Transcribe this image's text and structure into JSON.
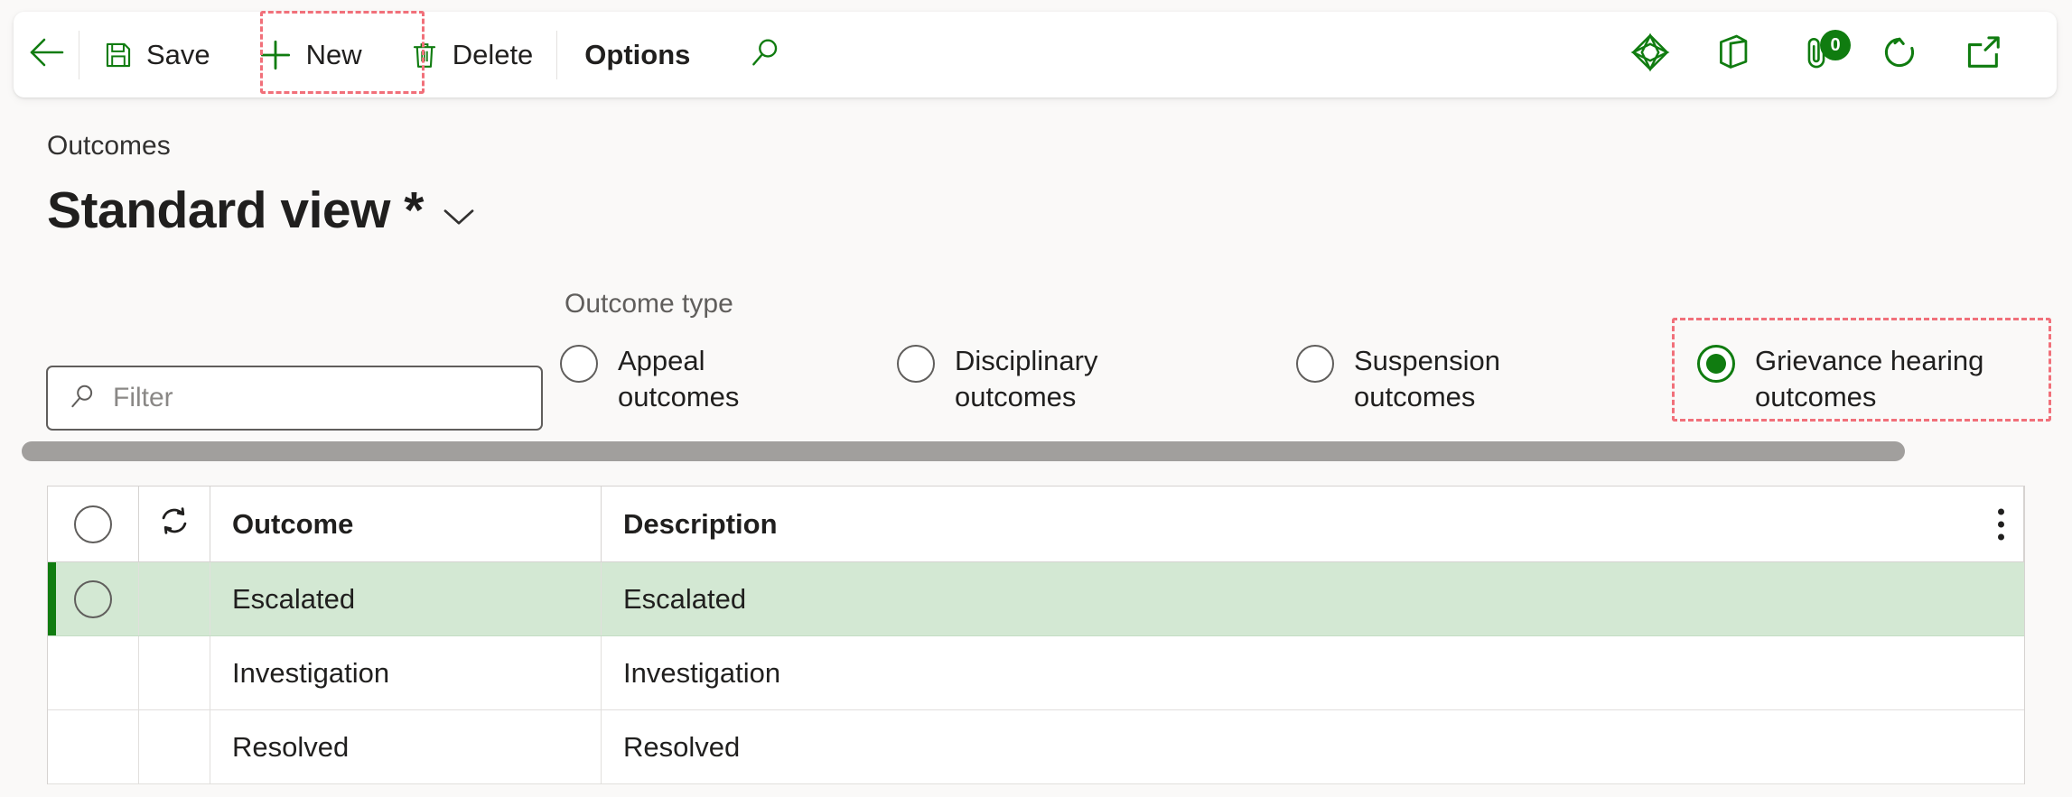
{
  "colors": {
    "accent_green": "#107c10",
    "highlight_red": "#f1707a",
    "selected_row_bg": "#d3e8d3",
    "page_bg": "#faf9f8"
  },
  "commandbar": {
    "back_label": "Back",
    "save_label": "Save",
    "new_label": "New",
    "delete_label": "Delete",
    "options_label": "Options",
    "search_label": "Search",
    "attachments_badge": "0",
    "icons": {
      "back": "back-arrow-icon",
      "save": "floppy-disk-save-icon",
      "new": "plus-icon",
      "delete": "trash-can-icon",
      "search": "magnifier-icon",
      "powerapps": "power-apps-diamond-icon",
      "office": "office-app-launcher-icon",
      "attachments": "paperclip-icon",
      "refresh": "refresh-circular-arrow-icon",
      "popout": "open-in-new-window-icon"
    }
  },
  "header": {
    "breadcrumb": "Outcomes",
    "title": "Standard view *",
    "title_chevron": "chevron-down-icon"
  },
  "filter": {
    "placeholder": "Filter",
    "value": "",
    "icon": "magnifier-icon"
  },
  "outcome_type": {
    "group_label": "Outcome type",
    "options": [
      {
        "label": "Appeal outcomes",
        "line1": "Appeal",
        "line2": "outcomes",
        "checked": false
      },
      {
        "label": "Disciplinary outcomes",
        "line1": "Disciplinary",
        "line2": "outcomes",
        "checked": false
      },
      {
        "label": "Suspension outcomes",
        "line1": "Suspension",
        "line2": "outcomes",
        "checked": false
      },
      {
        "label": "Grievance hearing outcomes",
        "line1": "Grievance hearing",
        "line2": "outcomes",
        "checked": true
      }
    ]
  },
  "grid": {
    "columns": {
      "select_all": "select-all-circle",
      "refresh": "refresh-icon",
      "outcome": "Outcome",
      "description": "Description"
    },
    "overflow_menu": "more-options-kebab",
    "rows": [
      {
        "outcome": "Escalated",
        "description": "Escalated",
        "selected": true
      },
      {
        "outcome": "Investigation",
        "description": "Investigation",
        "selected": false
      },
      {
        "outcome": "Resolved",
        "description": "Resolved",
        "selected": false
      }
    ]
  },
  "scrollbar": {
    "orientation": "horizontal",
    "name": "horizontal-scrollbar"
  }
}
